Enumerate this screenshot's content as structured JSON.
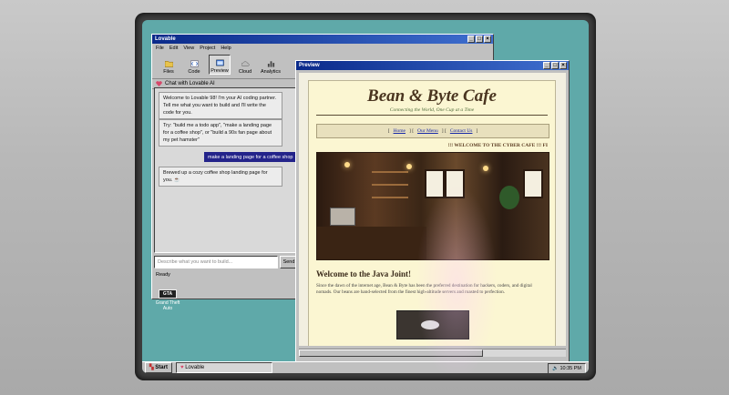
{
  "lovable_window": {
    "title": "Lovable",
    "menu": [
      "File",
      "Edit",
      "View",
      "Project",
      "Help"
    ],
    "toolbar": [
      {
        "label": "Files",
        "icon": "folder-icon"
      },
      {
        "label": "Code",
        "icon": "code-icon"
      },
      {
        "label": "Preview",
        "icon": "preview-icon",
        "active": true
      },
      {
        "label": "Cloud",
        "icon": "cloud-icon"
      },
      {
        "label": "Analytics",
        "icon": "analytics-icon"
      }
    ],
    "chat_header": "Chat with Lovable AI",
    "messages": [
      {
        "role": "ai",
        "text": "Welcome to Lovable 98! I'm your AI coding partner. Tell me what you want to build and I'll write the code for you."
      },
      {
        "role": "ai",
        "text": "Try: \"build me a todo app\", \"make a landing page for a coffee shop\", or \"build a 90s fan page about my pet hamster\""
      },
      {
        "role": "user",
        "text": "make a landing page for a coffee shop"
      },
      {
        "role": "ai",
        "text": "Brewed up a cozy coffee shop landing page for you. ☕"
      }
    ],
    "input_placeholder": "Describe what you want to build...",
    "send_label": "Send",
    "status": "Ready"
  },
  "desktop_icon": {
    "badge": "GTA",
    "label": "Grand Theft Auto"
  },
  "preview_window": {
    "title": "Preview",
    "site": {
      "title": "Bean & Byte Cafe",
      "tagline": "Connecting the World, One Cup at a Time",
      "nav": [
        "Home",
        "Our Menu",
        "Contact Us"
      ],
      "marquee": "!!! WELCOME TO THE CYBER CAFE !!! FI",
      "welcome_heading": "Welcome to the Java Joint!",
      "paragraph": "Since the dawn of the internet age, Bean & Byte has been the preferred destination for hackers, coders, and digital nomads. Our beans are hand-selected from the finest high-altitude servers and roasted to perfection."
    }
  },
  "taskbar": {
    "start_label": "Start",
    "task_label": "Lovable",
    "clock": "10:35 PM"
  },
  "colors": {
    "desktop": "#5fa9a9",
    "titlebar": "#0a2a8a",
    "user_bubble": "#23238a",
    "site_bg": "#fbf6d2",
    "site_title": "#4a3520"
  }
}
